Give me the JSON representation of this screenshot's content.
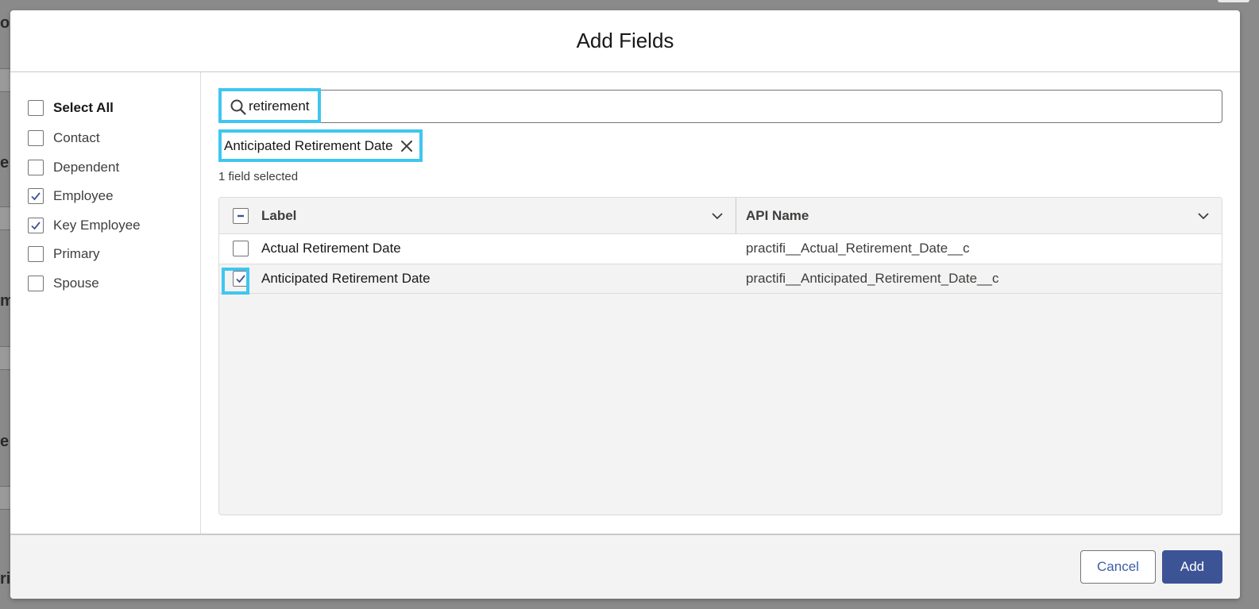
{
  "background": {
    "fragments": [
      "o",
      "e",
      "m",
      "e",
      "ri"
    ]
  },
  "modal": {
    "title": "Add Fields"
  },
  "filters": {
    "select_all": {
      "label": "Select All",
      "checked": false
    },
    "items": [
      {
        "label": "Contact",
        "checked": false
      },
      {
        "label": "Dependent",
        "checked": false
      },
      {
        "label": "Employee",
        "checked": true
      },
      {
        "label": "Key Employee",
        "checked": true
      },
      {
        "label": "Primary",
        "checked": false
      },
      {
        "label": "Spouse",
        "checked": false
      }
    ]
  },
  "search": {
    "value": "retirement",
    "icon": "search-icon"
  },
  "selected_pill": {
    "label": "Anticipated Retirement Date",
    "icon": "close-icon"
  },
  "selected_count": "1 field selected",
  "table": {
    "columns": [
      {
        "label": "Label"
      },
      {
        "label": "API Name"
      }
    ],
    "header_checkbox_state": "indeterminate",
    "rows": [
      {
        "label": "Actual Retirement Date",
        "api_name": "practifi__Actual_Retirement_Date__c",
        "checked": false
      },
      {
        "label": "Anticipated Retirement Date",
        "api_name": "practifi__Anticipated_Retirement_Date__c",
        "checked": true
      }
    ]
  },
  "footer": {
    "cancel_label": "Cancel",
    "add_label": "Add"
  },
  "colors": {
    "brand": "#3c5496",
    "highlight": "#3fc6f0",
    "link": "#3b5ea8"
  }
}
